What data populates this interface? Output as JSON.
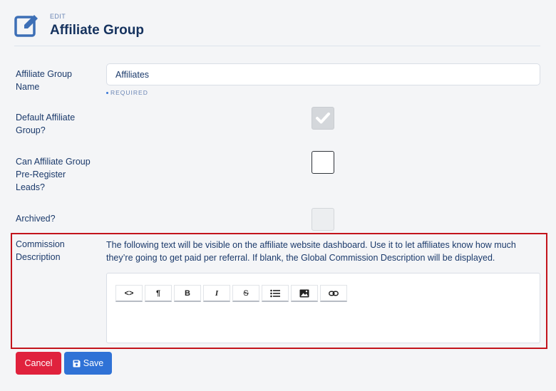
{
  "header": {
    "kicker": "EDIT",
    "title": "Affiliate Group",
    "icon": "edit-icon"
  },
  "fields": {
    "group_name": {
      "label": "Affiliate Group Name",
      "value": "Affiliates",
      "required_text": "REQUIRED"
    },
    "default_group": {
      "label": "Default Affiliate Group?",
      "checked": true,
      "disabled": true
    },
    "pre_register": {
      "label": "Can Affiliate Group Pre-Register Leads?",
      "checked": false,
      "disabled": false
    },
    "archived": {
      "label": "Archived?",
      "checked": false,
      "disabled": true
    },
    "commission": {
      "label": "Commission Description",
      "help": "The following text will be visible on the affiliate website dashboard. Use it to let affiliates know how much they’re going to get paid per referral. If blank, the Global Commission Description will be displayed.",
      "value": ""
    }
  },
  "toolbar": {
    "buttons": [
      {
        "name": "code-button",
        "icon": "code-icon",
        "glyph": "<>"
      },
      {
        "name": "paragraph-button",
        "icon": "paragraph-icon",
        "glyph": "¶"
      },
      {
        "name": "bold-button",
        "icon": "bold-icon",
        "glyph": "B"
      },
      {
        "name": "italic-button",
        "icon": "italic-icon",
        "glyph": "I"
      },
      {
        "name": "strikethrough-button",
        "icon": "strikethrough-icon",
        "glyph": "S"
      },
      {
        "name": "list-button",
        "icon": "list-icon",
        "glyph": ""
      },
      {
        "name": "image-button",
        "icon": "image-icon",
        "glyph": ""
      },
      {
        "name": "link-button",
        "icon": "link-icon",
        "glyph": ""
      }
    ]
  },
  "actions": {
    "cancel_label": "Cancel",
    "save_label": "Save"
  },
  "colors": {
    "primary": "#2f72d6",
    "danger": "#e0223d",
    "text": "#1b3a6b",
    "highlight": "#c3141c"
  }
}
